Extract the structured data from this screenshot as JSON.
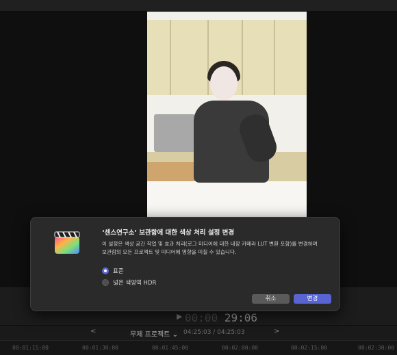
{
  "dialog": {
    "title": "‘센스연구소’ 보관함에 대한 색상 처리 설정 변경",
    "body_line1": "이 설정은 색상 공간 작업 및 효과 처리(로그 미디어에 대한 내장 카메라 LUT 변환 포함)를 변경하며",
    "body_line2": "보관함의 모든 프로젝트 및 미디어에 영향을 미칠 수 있습니다.",
    "options": [
      {
        "label": "표준",
        "selected": true
      },
      {
        "label": "넓은 색영역 HDR",
        "selected": false
      }
    ],
    "cancel_label": "취소",
    "confirm_label": "변경"
  },
  "viewer": {
    "timecode_dim": "00:00",
    "timecode": "29:06"
  },
  "project": {
    "name": "무제 프로젝트",
    "dropdown_glyph": "⌄",
    "duration": "04:25:03 / 04:25:03",
    "nav_prev": "<",
    "nav_next": ">"
  },
  "timeline": {
    "ruler_ticks": [
      "00:01:15:00",
      "00:01:30:00",
      "00:01:45:00",
      "00:02:00:00",
      "00:02:15:00",
      "00:02:30:00"
    ]
  },
  "icons": {
    "app": "final-cut-pro-icon",
    "play": "play-icon"
  },
  "colors": {
    "accent": "#5864d1"
  }
}
